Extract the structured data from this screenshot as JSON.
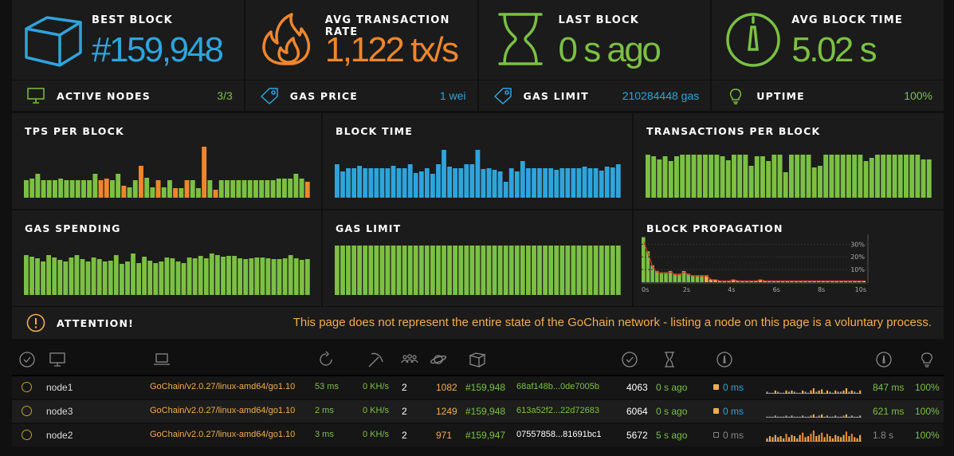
{
  "stats": [
    {
      "label": "BEST BLOCK",
      "value": "#159,948",
      "color": "#2ea4dc",
      "icon": "cube-icon"
    },
    {
      "label": "AVG TRANSACTION RATE",
      "value": "1,122 tx/s",
      "color": "#f0862c",
      "icon": "flame-icon"
    },
    {
      "label": "LAST BLOCK",
      "value": "0 s ago",
      "color": "#7bc043",
      "icon": "hourglass-icon"
    },
    {
      "label": "AVG BLOCK TIME",
      "value": "5.02 s",
      "color": "#7bc043",
      "icon": "gauge-icon"
    }
  ],
  "info": [
    {
      "label": "ACTIVE NODES",
      "value": "3/3",
      "color": "#7bc043",
      "icon": "desktop-icon"
    },
    {
      "label": "GAS PRICE",
      "value": "1 wei",
      "color": "#2ea4dc",
      "icon": "tag-icon"
    },
    {
      "label": "GAS LIMIT",
      "value": "210284448 gas",
      "color": "#2ea4dc",
      "icon": "tag-icon"
    },
    {
      "label": "UPTIME",
      "value": "100%",
      "color": "#7bc043",
      "icon": "lightbulb-icon"
    }
  ],
  "colors": {
    "green": "#7bc043",
    "orange": "#f0862c",
    "blue": "#2ea4dc",
    "yellow": "#f0ad4e",
    "propagation_line": "#e0312a"
  },
  "chart_data": [
    {
      "type": "bar",
      "title": "TPS PER BLOCK",
      "values": [
        22,
        24,
        30,
        22,
        22,
        22,
        24,
        22,
        22,
        22,
        22,
        22,
        30,
        22,
        24,
        22,
        30,
        15,
        13,
        22,
        40,
        25,
        13,
        22,
        13,
        22,
        12,
        12,
        22,
        22,
        12,
        64,
        22,
        10,
        22,
        22,
        22,
        22,
        22,
        22,
        22,
        22,
        22,
        22,
        24,
        24,
        24,
        30,
        24,
        20
      ],
      "highlight": [
        13,
        14,
        17,
        20,
        23,
        26,
        28,
        31,
        33,
        49
      ],
      "highlight_color": "#f0862c",
      "color": "#7bc043"
    },
    {
      "type": "bar",
      "title": "BLOCK TIME",
      "values": [
        42,
        33,
        37,
        37,
        40,
        37,
        37,
        37,
        37,
        37,
        40,
        37,
        37,
        42,
        31,
        33,
        37,
        30,
        42,
        60,
        39,
        37,
        37,
        42,
        42,
        60,
        36,
        37,
        35,
        33,
        20,
        37,
        33,
        46,
        37,
        37,
        37,
        37,
        37,
        35,
        37,
        37,
        37,
        37,
        39,
        37,
        37,
        34,
        39,
        38,
        42
      ],
      "color": "#2ea4dc"
    },
    {
      "type": "bar",
      "title": "TRANSACTIONS PER BLOCK",
      "values": [
        54,
        52,
        48,
        52,
        46,
        52,
        54,
        54,
        54,
        54,
        54,
        54,
        54,
        52,
        47,
        54,
        54,
        54,
        40,
        52,
        52,
        46,
        54,
        54,
        32,
        54,
        54,
        54,
        54,
        38,
        40,
        54,
        54,
        54,
        54,
        54,
        54,
        54,
        46,
        50,
        54,
        54,
        54,
        54,
        54,
        54,
        54,
        54,
        48,
        48
      ],
      "color": "#7bc043"
    },
    {
      "type": "bar",
      "title": "GAS SPENDING",
      "values": [
        50,
        48,
        46,
        42,
        50,
        47,
        44,
        42,
        47,
        50,
        45,
        42,
        47,
        45,
        42,
        43,
        50,
        39,
        42,
        52,
        40,
        48,
        43,
        40,
        42,
        47,
        46,
        42,
        40,
        47,
        46,
        49,
        46,
        52,
        50,
        48,
        49,
        49,
        46,
        45,
        46,
        47,
        47,
        46,
        45,
        45,
        46,
        50,
        46,
        44,
        45
      ],
      "color": "#7bc043"
    },
    {
      "type": "bar",
      "title": "GAS LIMIT",
      "values": [
        62,
        62,
        62,
        62,
        62,
        62,
        62,
        62,
        62,
        62,
        62,
        62,
        62,
        62,
        62,
        62,
        62,
        62,
        62,
        62,
        62,
        62,
        62,
        62,
        62,
        62,
        62,
        62,
        62,
        62,
        62,
        62,
        62,
        62,
        62,
        62,
        62,
        62,
        62,
        62,
        62,
        62,
        62,
        62,
        62,
        62,
        62,
        62,
        62,
        62,
        62
      ],
      "color": "#7bc043"
    },
    {
      "type": "histogram",
      "title": "BLOCK PROPAGATION",
      "x_ticks": [
        "0s",
        "2s",
        "4s",
        "6s",
        "8s",
        "10s"
      ],
      "y_ticks": [
        "30%",
        "20%",
        "10%"
      ],
      "values": [
        32,
        22,
        12,
        8,
        7,
        7,
        8,
        6,
        6,
        8,
        6,
        5,
        5,
        5,
        5,
        2,
        2,
        1,
        1,
        1,
        2,
        1,
        1,
        1,
        1,
        1,
        2,
        1,
        1,
        1,
        1,
        1,
        1,
        1,
        1,
        1,
        1,
        1,
        1,
        1,
        1,
        1,
        1,
        1,
        1,
        1,
        1,
        1,
        1,
        1
      ],
      "color": "#7bc043"
    }
  ],
  "attention": {
    "label": "ATTENTION!",
    "message": "This page does not represent the entire state of the GoChain network - listing a node on this page is a voluntary process."
  },
  "table_header_icons": [
    "check-circle-icon",
    "desktop-icon",
    "laptop-icon",
    "refresh-icon",
    "pickaxe-icon",
    "users-icon",
    "planet-icon",
    "cube-icon",
    "check-circle-icon",
    "hourglass-icon",
    "gauge-icon",
    "gauge-icon",
    "lightbulb-icon"
  ],
  "nodes": [
    {
      "name": "node1",
      "client": "GoChain/v2.0.27/linux-amd64/go1.10",
      "latency": "53 ms",
      "hashrate": "0 KH/s",
      "peers": "2",
      "pending": "1082",
      "block": "#159,948",
      "hash": "68af148b...0de7005b",
      "difficulty": "4063",
      "last": "0 s ago",
      "prop": "0 ms",
      "avg_prop": "847 ms",
      "uptime": "100%",
      "prop_active": true,
      "spark": [
        2,
        1,
        1,
        3,
        2,
        1,
        1,
        3,
        2,
        3,
        2,
        1,
        1,
        3,
        2,
        1,
        3,
        5,
        2,
        3,
        4,
        1,
        3,
        2,
        1,
        3,
        2,
        2,
        3,
        5,
        2,
        3,
        2,
        1,
        3
      ]
    },
    {
      "name": "node3",
      "client": "GoChain/v2.0.27/linux-amd64/go1.10",
      "latency": "2 ms",
      "hashrate": "0 KH/s",
      "peers": "2",
      "pending": "1249",
      "block": "#159,948",
      "hash": "613a52f2...22d72683",
      "difficulty": "6064",
      "last": "0 s ago",
      "prop": "0 ms",
      "avg_prop": "621 ms",
      "uptime": "100%",
      "prop_active": true,
      "spark": [
        1,
        1,
        1,
        2,
        1,
        1,
        1,
        2,
        1,
        2,
        1,
        1,
        1,
        2,
        1,
        1,
        2,
        3,
        1,
        2,
        3,
        1,
        2,
        1,
        1,
        2,
        1,
        1,
        2,
        3,
        1,
        2,
        1,
        1,
        2
      ]
    },
    {
      "name": "node2",
      "client": "GoChain/v2.0.27/linux-amd64/go1.10",
      "latency": "3 ms",
      "hashrate": "0 KH/s",
      "peers": "2",
      "pending": "971",
      "block": "#159,947",
      "hash": "07557858...81691bc1",
      "difficulty": "5672",
      "last": "5 s ago",
      "prop": "0 ms",
      "avg_prop": "1.8 s",
      "uptime": "100%",
      "prop_active": false,
      "spark": [
        3,
        5,
        4,
        6,
        4,
        5,
        3,
        7,
        4,
        6,
        5,
        3,
        6,
        8,
        4,
        5,
        7,
        10,
        5,
        6,
        8,
        4,
        7,
        5,
        3,
        6,
        5,
        4,
        6,
        9,
        5,
        7,
        4,
        3,
        6
      ]
    }
  ]
}
